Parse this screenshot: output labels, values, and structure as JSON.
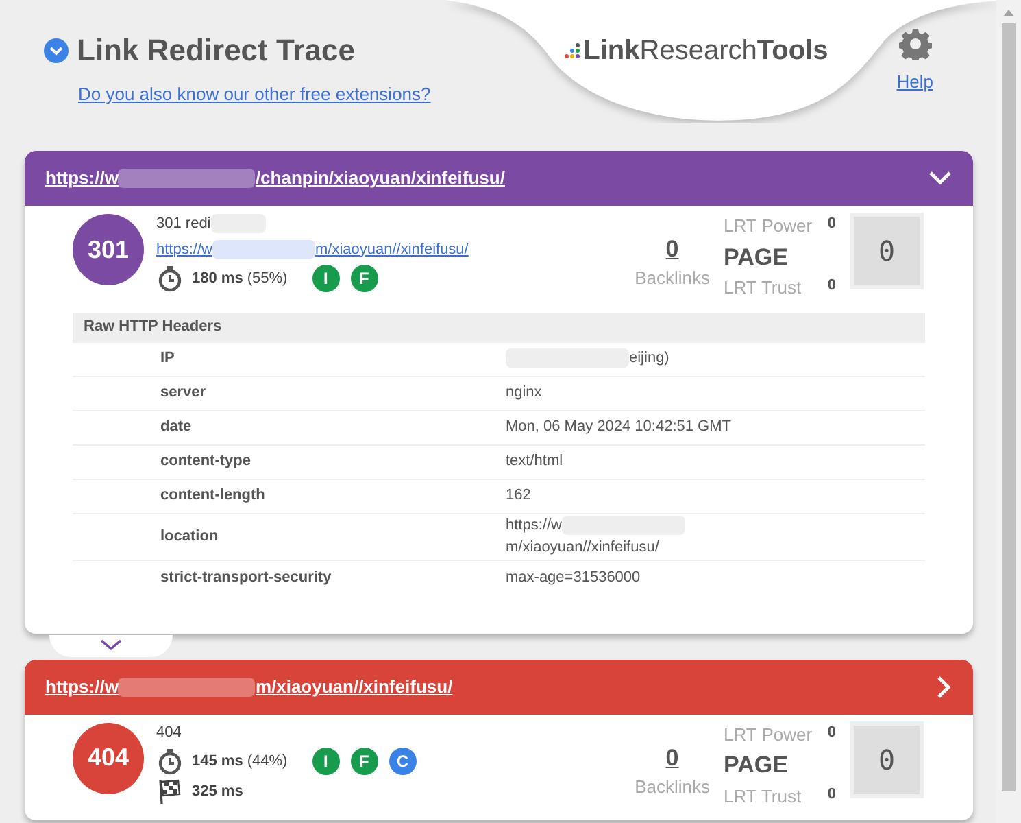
{
  "header": {
    "title": "Link Redirect Trace",
    "link": "Do you also know our other free extensions?",
    "logo": "**Link**Research**Tools**",
    "help": "Help"
  },
  "hops": [
    {
      "url_start": "https://w",
      "url_end": "/chanpin/xiaoyuan/xinfeifusu/",
      "expanded": true,
      "color": "#7b4aa3",
      "code": "301",
      "status_text": "301 redi",
      "status_redacted": true,
      "location_start": "https://w",
      "location_end": "m/xiaoyuan//xinfeifusu/",
      "time": "180 ms",
      "time_pct": "(55%)",
      "badges": [
        {
          "label": "I",
          "color": "#169c4c"
        },
        {
          "label": "F",
          "color": "#169c4c"
        }
      ],
      "backlinks": "0",
      "backlinks_label": "Backlinks",
      "lrt_power_label": "LRT Power",
      "lrt_power": "0",
      "page": "PAGE",
      "lrt_trust_label": "LRT Trust",
      "lrt_trust": "0",
      "score": "0",
      "headers": {
        "title": "Raw HTTP Headers",
        "rows": [
          {
            "name": "IP",
            "redacted": true,
            "before": "",
            "after": "eijing)"
          },
          {
            "name": "server",
            "value": "nginx"
          },
          {
            "name": "date",
            "value": "Mon, 06 May 2024 10:42:51 GMT"
          },
          {
            "name": "content-type",
            "value": "text/html"
          },
          {
            "name": "content-length",
            "value": "162"
          },
          {
            "name": "location",
            "redacted": true,
            "before": "https://w",
            "after": "m/xiaoyuan//xinfeifusu/"
          },
          {
            "name": "strict-transport-security",
            "value": "max-age=31536000"
          }
        ]
      }
    },
    {
      "url_start": "https://w",
      "url_end": "m/xiaoyuan//xinfeifusu/",
      "expanded": false,
      "color": "#d9443a",
      "code": "404",
      "status_text": "404",
      "status_redacted": false,
      "time": "145 ms",
      "time_pct": "(44%)",
      "total_time": "325 ms",
      "badges": [
        {
          "label": "I",
          "color": "#169c4c"
        },
        {
          "label": "F",
          "color": "#169c4c"
        },
        {
          "label": "C",
          "color": "#3b82e6"
        }
      ],
      "backlinks": "0",
      "backlinks_label": "Backlinks",
      "lrt_power_label": "LRT Power",
      "lrt_power": "0",
      "page": "PAGE",
      "lrt_trust_label": "LRT Trust",
      "lrt_trust": "0",
      "score": "0"
    }
  ]
}
